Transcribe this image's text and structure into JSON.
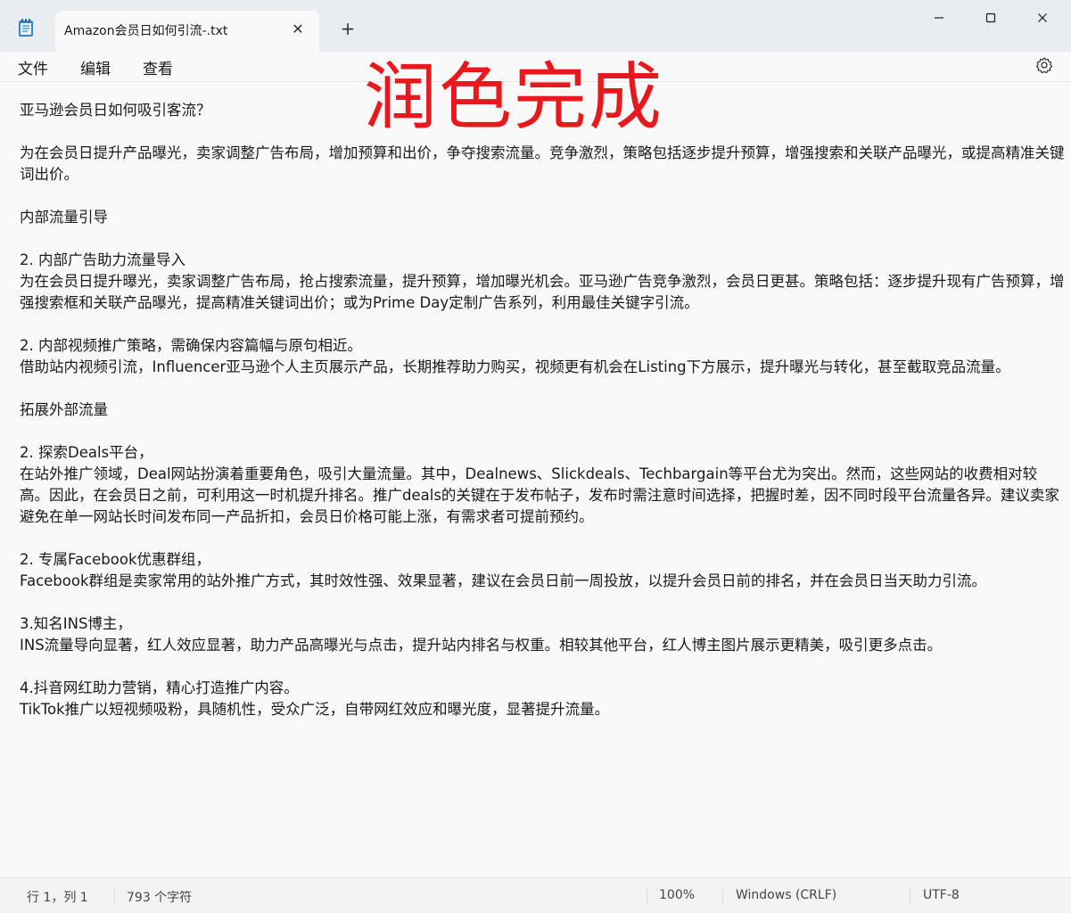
{
  "window": {
    "tab_title": "Amazon会员日如何引流-.txt",
    "tab_close": "✕",
    "new_tab": "+"
  },
  "menu": {
    "file": "文件",
    "edit": "编辑",
    "view": "查看"
  },
  "overlay": {
    "text": "润色完成",
    "color": "#e8191c"
  },
  "editor": {
    "lines": [
      "亚马逊会员日如何吸引客流？",
      "",
      "为在会员日提升产品曝光，卖家调整广告布局，增加预算和出价，争夺搜索流量。竞争激烈，策略包括逐步提升预算，增强搜索和关联产品曝光，或提高精准关键词出价。",
      "",
      "内部流量引导",
      "",
      "2. 内部广告助力流量导入",
      "为在会员日提升曝光，卖家调整广告布局，抢占搜索流量，提升预算，增加曝光机会。亚马逊广告竞争激烈，会员日更甚。策略包括：逐步提升现有广告预算，增强搜索框和关联产品曝光，提高精准关键词出价；或为Prime Day定制广告系列，利用最佳关键字引流。",
      "",
      "2. 内部视频推广策略，需确保内容篇幅与原句相近。",
      "借助站内视频引流，Influencer亚马逊个人主页展示产品，长期推荐助力购买，视频更有机会在Listing下方展示，提升曝光与转化，甚至截取竞品流量。",
      "",
      "拓展外部流量",
      "",
      "2. 探索Deals平台，",
      "在站外推广领域，Deal网站扮演着重要角色，吸引大量流量。其中，Dealnews、Slickdeals、Techbargain等平台尤为突出。然而，这些网站的收费相对较高。因此，在会员日之前，可利用这一时机提升排名。推广deals的关键在于发布帖子，发布时需注意时间选择，把握时差，因不同时段平台流量各异。建议卖家避免在单一网站长时间发布同一产品折扣，会员日价格可能上涨，有需求者可提前预约。",
      "",
      "2. 专属Facebook优惠群组，",
      "Facebook群组是卖家常用的站外推广方式，其时效性强、效果显著，建议在会员日前一周投放，以提升会员日前的排名，并在会员日当天助力引流。",
      "",
      "3.知名INS博主，",
      "INS流量导向显著，红人效应显著，助力产品高曝光与点击，提升站内排名与权重。相较其他平台，红人博主图片展示更精美，吸引更多点击。",
      "",
      "4.抖音网红助力营销，精心打造推广内容。",
      "TikTok推广以短视频吸粉，具随机性，受众广泛，自带网红效应和曝光度，显著提升流量。"
    ]
  },
  "status": {
    "position": "行 1，列 1",
    "char_count": "793 个字符",
    "zoom": "100%",
    "line_ending": "Windows (CRLF)",
    "encoding": "UTF-8"
  },
  "icons": {
    "app": "notepad-icon",
    "settings": "gear-icon",
    "minimize": "minimize-icon",
    "maximize": "maximize-icon",
    "close": "close-icon"
  }
}
